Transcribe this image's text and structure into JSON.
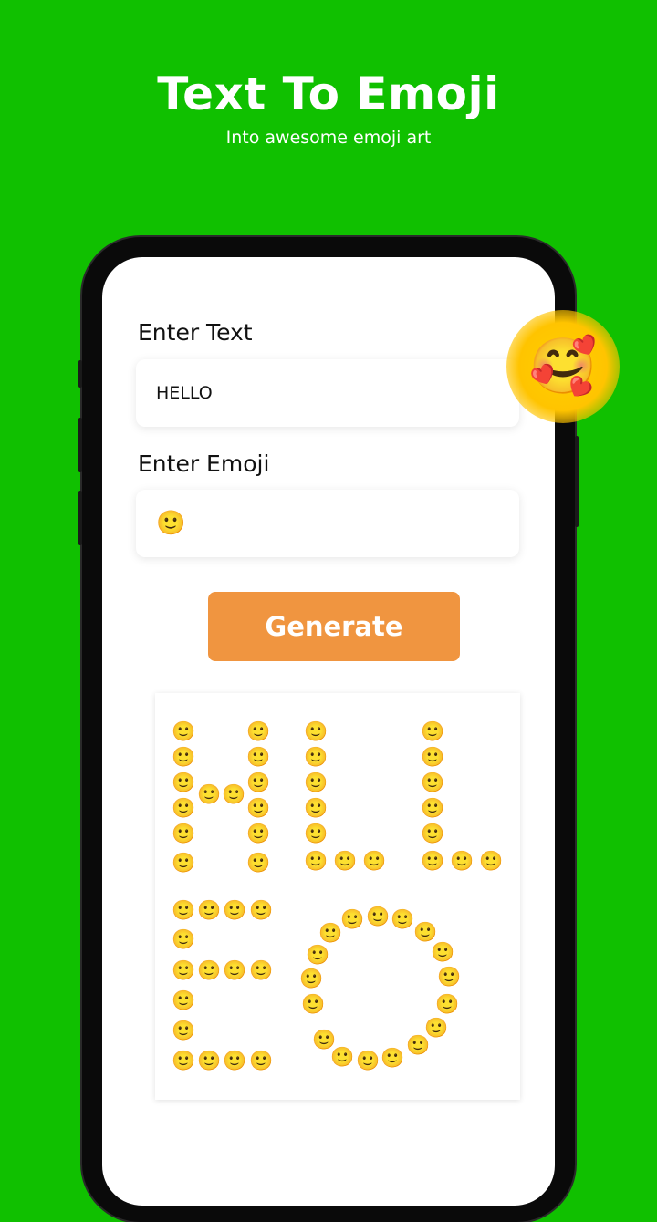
{
  "promo": {
    "headline": "Text To Emoji",
    "subheadline": "Into awesome emoji art"
  },
  "form": {
    "text_label": "Enter Text",
    "text_value": "HELLO",
    "emoji_label": "Enter Emoji",
    "emoji_value": "🙂",
    "generate_label": "Generate"
  },
  "art": {
    "source_text": "HELLO",
    "emoji": "🙂"
  },
  "sticker": {
    "emoji": "🥰"
  },
  "colors": {
    "background": "#10c000",
    "button": "#f09540"
  },
  "icons": [
    "smiling-hearts-emoji-icon",
    "slightly-smiling-emoji-icon"
  ]
}
